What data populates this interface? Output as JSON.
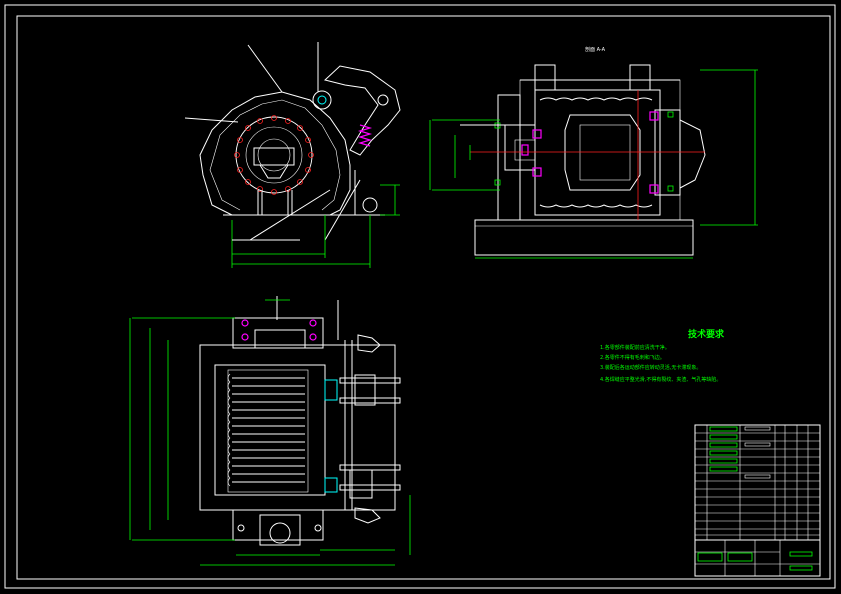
{
  "drawing": {
    "section_label": "剖面 A-A",
    "notes": {
      "title": "技术要求",
      "lines": [
        "1.各零部件装配前应清洗干净。",
        "2.各零件不得有毛刺和飞边。",
        "3.装配后各运动部件应转动灵活,无卡滞现象。",
        "4.各焊缝应平整光滑,不得有裂纹、夹渣、气孔等缺陷。"
      ]
    },
    "colors": {
      "background": "#000000",
      "outline": "#ffffff",
      "dimension": "#00ff00",
      "centerline": "#ff2020",
      "hatch": "#ff00ff",
      "accent": "#00ffff"
    }
  }
}
